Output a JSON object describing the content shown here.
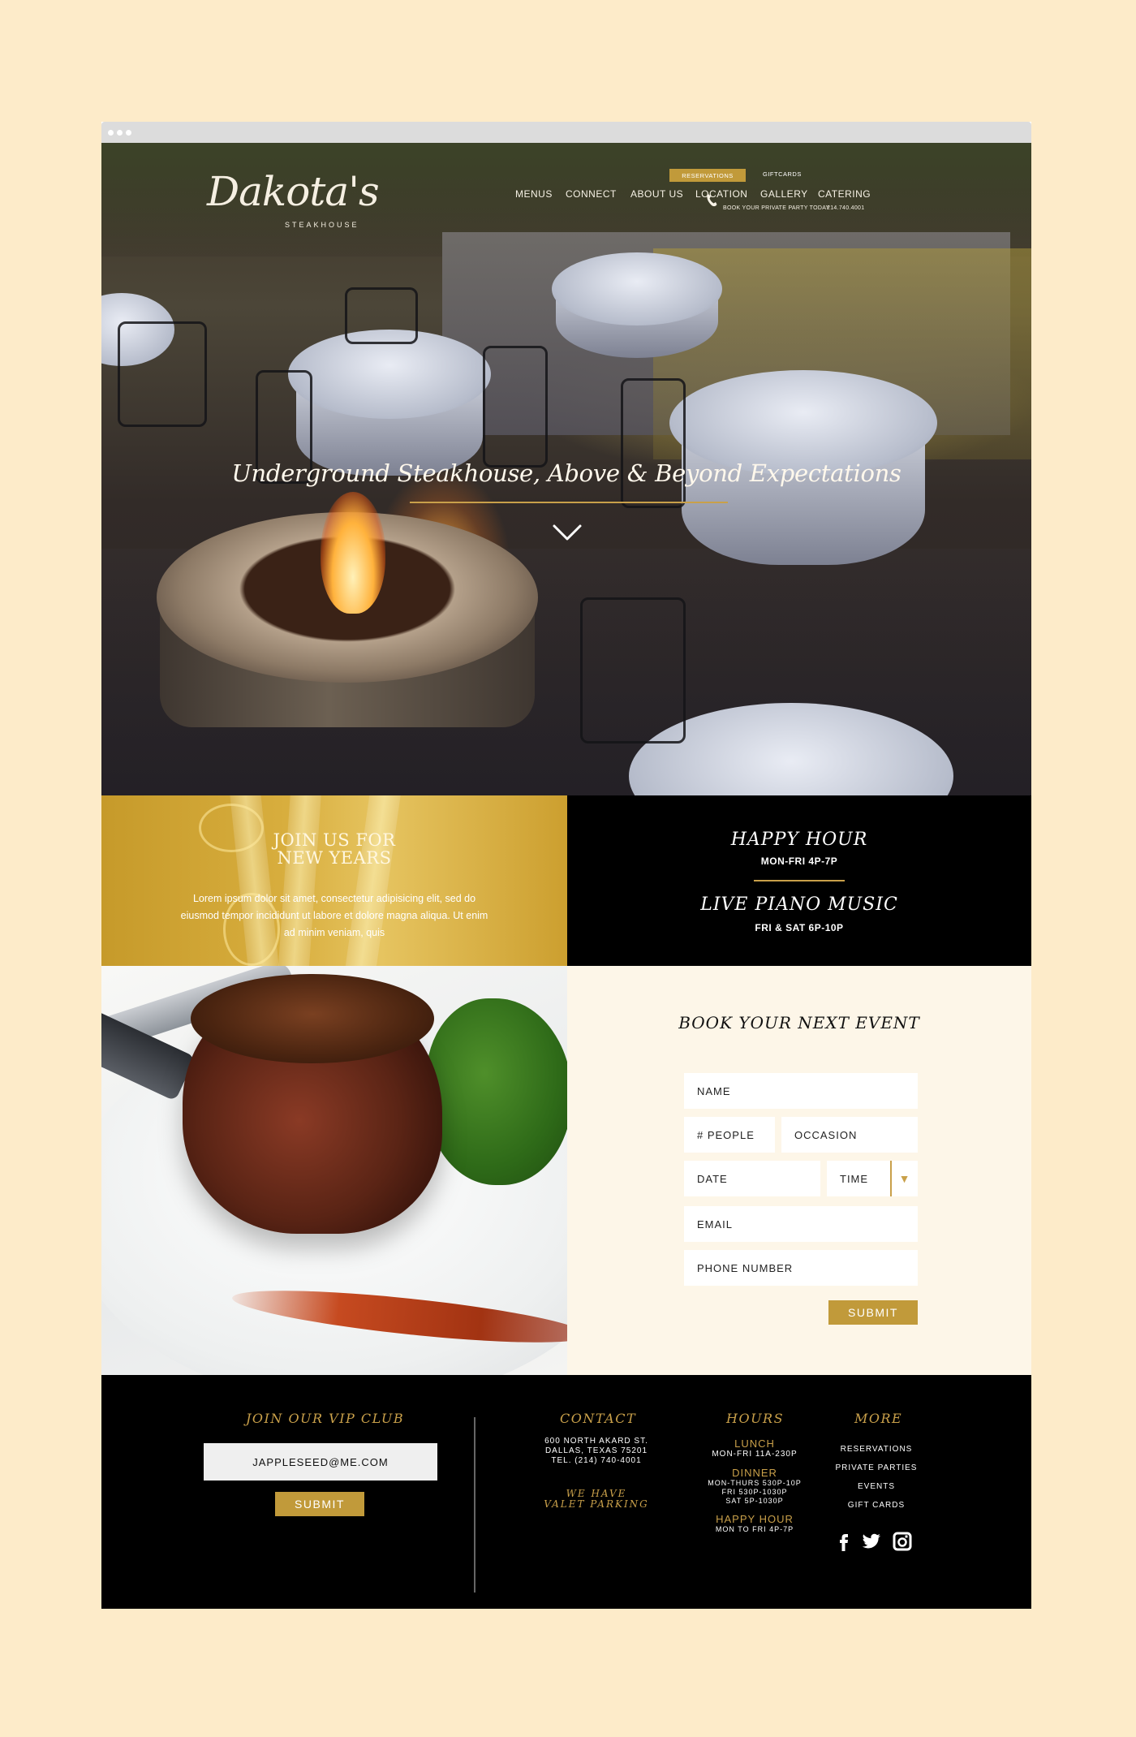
{
  "nav": {
    "logo_script": "Dakota's",
    "logo_sub": "STEAKHOUSE",
    "reservations": "RESERVATIONS",
    "giftcards": "GIFTCARDS",
    "items": [
      {
        "label": "MENUS"
      },
      {
        "label": "CONNECT"
      },
      {
        "label": "ABOUT US"
      },
      {
        "label": "LOCATION"
      },
      {
        "label": "GALLERY"
      },
      {
        "label": "CATERING"
      }
    ],
    "private_party": "BOOK YOUR PRIVATE PARTY TODAY",
    "phone": "214.740.4001"
  },
  "hero": {
    "title": "Underground Steakhouse, Above & Beyond Expectations"
  },
  "promo": {
    "new_years_title_1": "JOIN US FOR",
    "new_years_title_2": "NEW YEARS",
    "new_years_text": "Lorem ipsum dolor sit amet, consectetur adipisicing elit, sed do eiusmod tempor incididunt ut labore et dolore magna aliqua. Ut enim ad minim veniam, quis",
    "happy_hour_title": "HAPPY HOUR",
    "happy_hour_sub": "MON-FRI 4P-7P",
    "piano_title": "LIVE PIANO MUSIC",
    "piano_sub": "FRI & SAT 6P-10P"
  },
  "book": {
    "title": "BOOK YOUR NEXT EVENT",
    "name": "NAME",
    "people": "# PEOPLE",
    "occasion": "OCCASION",
    "date": "DATE",
    "time": "TIME",
    "email": "EMAIL",
    "phone": "PHONE NUMBER",
    "submit": "SUBMIT"
  },
  "footer": {
    "vip_title": "JOIN OUR VIP CLUB",
    "vip_value": "JAPPLESEED@ME.COM",
    "vip_submit": "SUBMIT",
    "contact_title": "CONTACT",
    "address_1": "600 NORTH AKARD ST.",
    "address_2": "DALLAS, TEXAS 75201",
    "address_3": "TEL. (214) 740-4001",
    "valet_1": "WE HAVE",
    "valet_2": "VALET PARKING",
    "hours_title": "HOURS",
    "lunch_label": "LUNCH",
    "lunch_time": "MON-FRI 11A-230P",
    "dinner_label": "DINNER",
    "dinner_time_1": "MON-THURS 530P-10P",
    "dinner_time_2": "FRI 530P-1030P",
    "dinner_time_3": "SAT 5P-1030P",
    "happy_label": "HAPPY HOUR",
    "happy_time": "MON TO FRI 4P-7P",
    "more_title": "MORE",
    "more_items": [
      {
        "label": "RESERVATIONS"
      },
      {
        "label": "PRIVATE PARTIES"
      },
      {
        "label": "EVENTS"
      },
      {
        "label": "GIFT CARDS"
      }
    ],
    "social": [
      "facebook-icon",
      "twitter-icon",
      "instagram-icon"
    ]
  },
  "colors": {
    "page_bg": "#fdebc9",
    "gold": "#c19a3a",
    "accent_line": "#c9a04a",
    "black": "#000000",
    "form_bg": "#fdf6e8"
  }
}
